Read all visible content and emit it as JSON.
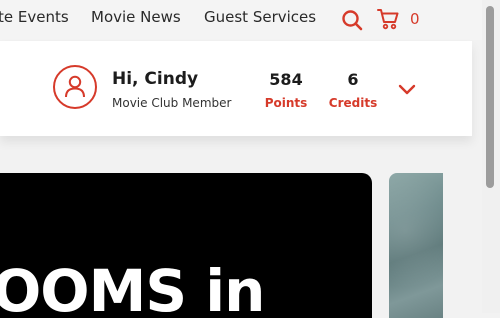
{
  "nav": {
    "links": [
      "te Events",
      "Movie News",
      "Guest Services"
    ],
    "cart_count": "0",
    "search_icon": "search-icon",
    "cart_icon": "cart-icon"
  },
  "member": {
    "greeting": "Hi, Cindy",
    "type": "Movie Club Member",
    "points_value": "584",
    "points_label": "Points",
    "credits_value": "6",
    "credits_label": "Credits"
  },
  "hero": {
    "text": "OOMS in"
  },
  "colors": {
    "accent": "#d63a2a",
    "background": "#f2f2f2",
    "hero": "#000000"
  }
}
